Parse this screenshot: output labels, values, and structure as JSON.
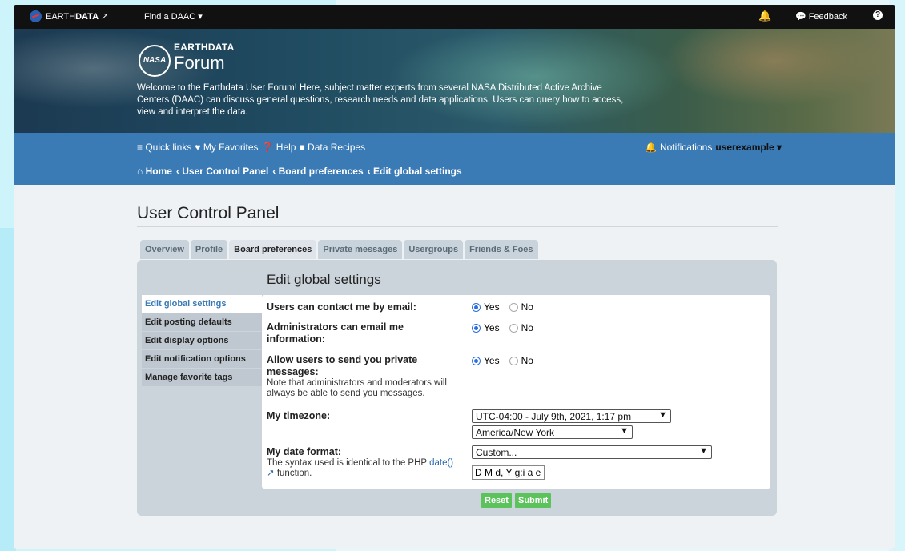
{
  "topbar": {
    "brand_pre": "EARTH",
    "brand_bold": "DATA",
    "find_daac": "Find a DAAC ▾",
    "feedback": "Feedback",
    "help": "?"
  },
  "hero": {
    "nasa": "NASA",
    "earthdata": "EARTHDATA",
    "forum": "Forum",
    "welcome": "Welcome to the Earthdata User Forum! Here, subject matter experts from several NASA Distributed Active Archive Centers (DAAC) can discuss general questions, research needs and data applications. Users can query how to access, view and interpret the data."
  },
  "nav": {
    "quick_links": "≡ Quick links",
    "favorites": "♥ My Favorites",
    "help": "❓ Help",
    "recipes": "■ Data Recipes",
    "notifications": "Notifications",
    "username": "userexample",
    "breadcrumbs": [
      "⌂ Home",
      "‹ User Control Panel",
      "‹ Board preferences",
      "‹ Edit global settings"
    ]
  },
  "page": {
    "title": "User Control Panel",
    "tabs": [
      "Overview",
      "Profile",
      "Board preferences",
      "Private messages",
      "Usergroups",
      "Friends & Foes"
    ],
    "sidenav": [
      "Edit global settings",
      "Edit posting defaults",
      "Edit display options",
      "Edit notification options",
      "Manage favorite tags"
    ],
    "section_title": "Edit global settings"
  },
  "form": {
    "contact_label": "Users can contact me by email:",
    "admin_label": "Administrators can email me information:",
    "pm_label": "Allow users to send you private messages:",
    "pm_note": "Note that administrators and moderators will always be able to send you messages.",
    "yes": "Yes",
    "no": "No",
    "timezone_label": "My timezone:",
    "timezone_value": "UTC-04:00 - July 9th, 2021, 1:17 pm",
    "timezone_region": "America/New York",
    "date_label": "My date format:",
    "date_note": "The syntax used is identical to the PHP",
    "date_link": "date()",
    "date_note2": "function.",
    "date_select": "Custom...",
    "date_value": "D M d, Y g:i a e",
    "reset": "Reset",
    "submit": "Submit"
  }
}
